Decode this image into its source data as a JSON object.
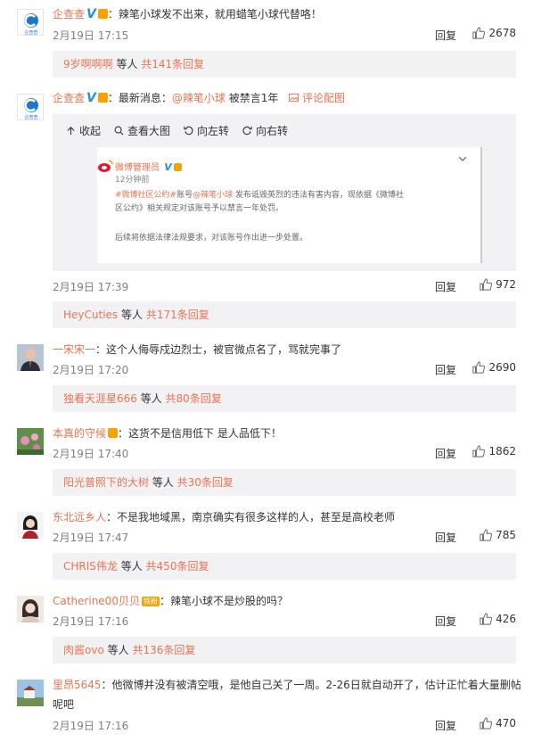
{
  "comments": [
    {
      "user": "企查查",
      "text": "：辣笔小球发不出来，就用蜡笔小球代替咯！",
      "date": "2月19日 17:15",
      "reply": "回复",
      "likes": "2678",
      "sub_users": "9岁啊啊啊",
      "sub_mid": " 等人 ",
      "sub_count": "共141条回复"
    },
    {
      "user": "企查查",
      "text_prefix": "：最新消息：",
      "mention": "@辣笔小球",
      "text_suffix": " 被禁言1年",
      "pic_link": "评论配图",
      "date": "2月19日 17:39",
      "reply": "回复",
      "likes": "972",
      "sub_users": "HeyCuties",
      "sub_mid": " 等人 ",
      "sub_count": "共171条回复"
    },
    {
      "user": "一宋宋一",
      "text": "：这个人侮辱戍边烈士，被官微点名了，骂就完事了",
      "date": "2月19日 17:20",
      "reply": "回复",
      "likes": "2690",
      "sub_users": "独看天涯星666",
      "sub_mid": " 等人 ",
      "sub_count": "共80条回复"
    },
    {
      "user": "本真的守候",
      "text": "：这货不是信用低下 是人品低下！",
      "date": "2月19日 17:40",
      "reply": "回复",
      "likes": "1862",
      "sub_users": "阳光普照下的大树",
      "sub_mid": " 等人 ",
      "sub_count": "共30条回复"
    },
    {
      "user": "东北远乡人",
      "text": "：不是我地域黑，南京确实有很多这样的人，甚至是高校老师",
      "date": "2月19日 17:47",
      "reply": "回复",
      "likes": "785",
      "sub_users": "CHRIS伟龙",
      "sub_mid": " 等人 ",
      "sub_count": "共450条回复"
    },
    {
      "user": "Catherine00贝贝",
      "fan_badge": "铁粉",
      "text": "：辣笔小球不是炒股的吗？",
      "date": "2月19日 17:16",
      "reply": "回复",
      "likes": "426",
      "sub_users": "肉酱ovo",
      "sub_mid": " 等人 ",
      "sub_count": "共136条回复"
    },
    {
      "user": "里昂5645",
      "text": "：他微博并没有被清空哦，是他自己关了一周。2-26日就自动开了，估计正忙着大量删帖",
      "text2": "呢吧",
      "date": "2月19日 17:16",
      "reply": "回复",
      "likes": "470"
    }
  ],
  "avatar_label": "企查查",
  "toolbar": {
    "collapse": "收起",
    "view_large": "查看大图",
    "rotate_left": "向左转",
    "rotate_right": "向右转"
  },
  "embed": {
    "account": "微博管理员",
    "time": "12分钟前",
    "line1_tag": "#微博社区公约#",
    "line1_a": "账号",
    "line1_mention": "@辣笔小球",
    "line1_b": " 发布诋毁英烈的违法有害内容，现依据《微博社",
    "line2": "区公约》相关规定对该账号予以禁言一年处罚。",
    "line3": "后续将依据法律法规要求，对该账号作出进一步处置。"
  },
  "colors": {
    "name": "#eb7350",
    "vip": "#1e90e6",
    "date": "#808080",
    "sub_bg": "#f2f2f5"
  }
}
